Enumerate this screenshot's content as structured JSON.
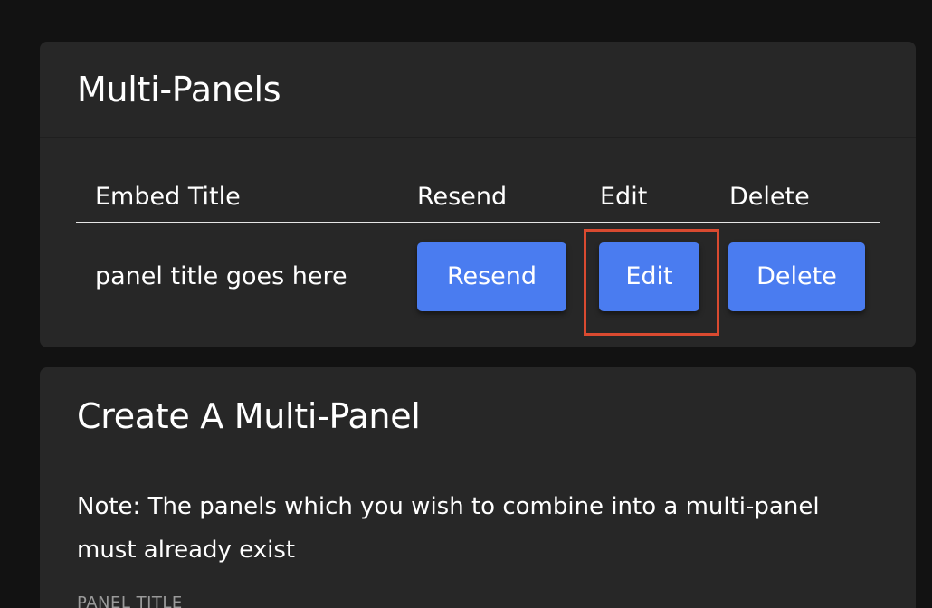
{
  "multi_panels": {
    "title": "Multi-Panels",
    "columns": {
      "embed_title": "Embed Title",
      "resend": "Resend",
      "edit": "Edit",
      "delete": "Delete"
    },
    "rows": [
      {
        "title": "panel title goes here",
        "resend_label": "Resend",
        "edit_label": "Edit",
        "delete_label": "Delete"
      }
    ]
  },
  "create": {
    "title": "Create A Multi-Panel",
    "note": "Note: The panels which you wish to combine into a multi-panel must already exist",
    "panel_title_label": "PANEL TITLE"
  },
  "colors": {
    "background": "#121212",
    "card": "#272727",
    "button": "#4a7cf0",
    "highlight": "#d94a30"
  }
}
